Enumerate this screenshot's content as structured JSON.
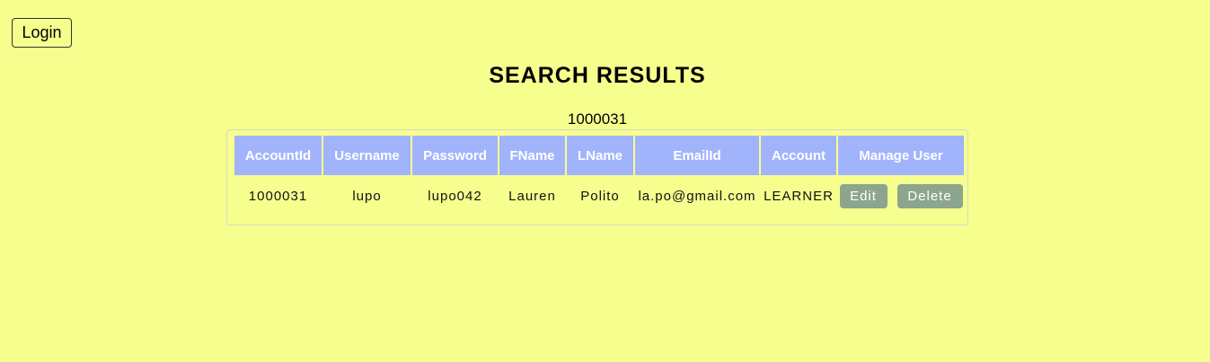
{
  "header": {
    "login_label": "Login"
  },
  "page": {
    "title": "SEARCH RESULTS",
    "query": "1000031"
  },
  "table": {
    "columns": [
      "AccountId",
      "Username",
      "Password",
      "FName",
      "LName",
      "EmailId",
      "Account",
      "Manage User"
    ],
    "rows": [
      {
        "account_id": "1000031",
        "username": "lupo",
        "password": "lupo042",
        "fname": "Lauren",
        "lname": "Polito",
        "email": "la.po@gmail.com",
        "account": "LEARNER",
        "edit_label": "Edit",
        "delete_label": "Delete"
      }
    ]
  },
  "colors": {
    "background": "#f6fe8e",
    "header_bg": "#a1b4fb",
    "button_bg": "#8ca58e"
  }
}
